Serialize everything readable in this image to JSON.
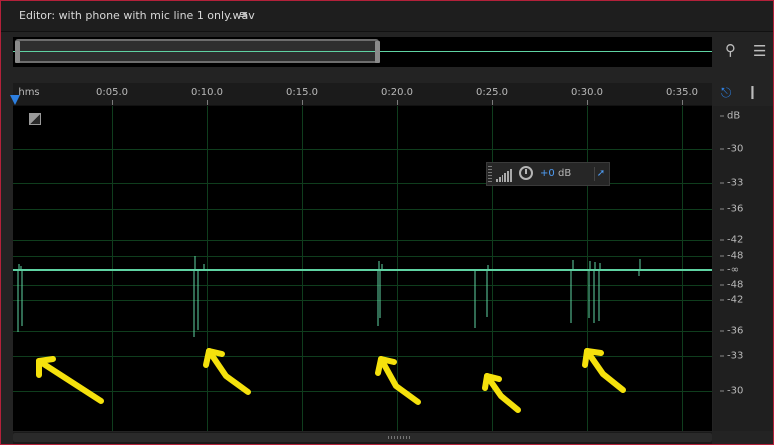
{
  "editor": {
    "title": "Editor: with phone with mic line 1 only.wav",
    "menu_icon": "panel-menu-icon"
  },
  "overview": {
    "selection_fraction": 0.52
  },
  "side_icons": {
    "zoom": "zoom-icon",
    "options": "list-options-icon",
    "snap": "magnet-snap-icon",
    "pin": "pin-icon"
  },
  "ruler": {
    "unit_label": "hms",
    "ticks": [
      "0:05.0",
      "0:10.0",
      "0:15.0",
      "0:20.0",
      "0:25.0",
      "0:30.0",
      "0:35.0"
    ]
  },
  "hud": {
    "value": "+0",
    "unit": "dB"
  },
  "db_scale": {
    "labels": [
      "dB",
      "-30",
      "-33",
      "-36",
      "-42",
      "-48",
      "-∞",
      "-48",
      "-42",
      "-36",
      "-33",
      "-30"
    ]
  },
  "colors": {
    "waveform": "#5fd3a3",
    "grid": "#0f3d1d",
    "annotation": "#f5e10c",
    "accent": "#2d7fe0"
  },
  "annotations": {
    "arrow_count": 5
  }
}
